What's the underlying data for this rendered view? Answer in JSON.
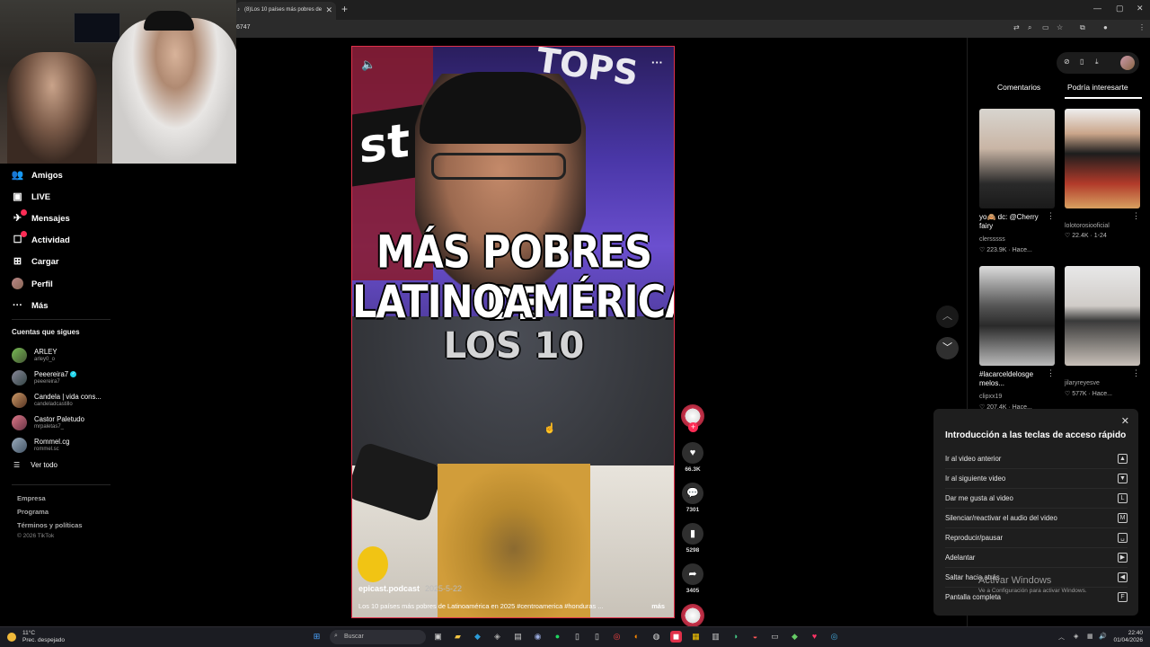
{
  "browser": {
    "tab_title": "(8)Los 10 países más pobres de",
    "url": "6747",
    "new_tab_icon": "plus-icon"
  },
  "sidebar": {
    "items": [
      {
        "label": "Amigos",
        "icon": "friends-icon"
      },
      {
        "label": "LIVE",
        "icon": "live-icon"
      },
      {
        "label": "Mensajes",
        "icon": "messages-icon"
      },
      {
        "label": "Actividad",
        "icon": "activity-icon"
      },
      {
        "label": "Cargar",
        "icon": "upload-icon"
      },
      {
        "label": "Perfil",
        "icon": "avatar"
      },
      {
        "label": "Más",
        "icon": "more-icon"
      }
    ],
    "following_title": "Cuentas que sigues",
    "following": [
      {
        "name": "ARLEY",
        "handle": "arley0_o"
      },
      {
        "name": "Peeereira7",
        "handle": "peeereira7"
      },
      {
        "name": "Candela | vida cons...",
        "handle": "candeladcastillo"
      },
      {
        "name": "Castor Paletudo",
        "handle": "mrpaletas7_"
      },
      {
        "name": "Rommel.cg",
        "handle": "rommel.sc"
      }
    ],
    "see_all": "Ver todo",
    "footer": [
      "Empresa",
      "Programa",
      "Términos y políticas"
    ],
    "copyright": "© 2026 TikTok"
  },
  "video": {
    "overlay_line1": "MÁS POBRES DE",
    "overlay_line2": "LATINOAMÉRICA",
    "overlay_line3": "LOS 10",
    "sign_text": "st",
    "top_text": "TOPS",
    "author": "epicast.podcast",
    "date": "2025-5-22",
    "description": "Los 10 países más pobres de Latinoamérica en 2025 #centroamerica #honduras ...",
    "more": "más"
  },
  "actions": {
    "likes": "66.3K",
    "comments": "7301",
    "saves": "5298",
    "shares": "3405"
  },
  "right_panel": {
    "tab_comments": "Comentarios",
    "tab_suggested": "Podría interesarte",
    "suggestions": [
      {
        "desc": "yo🙈 dc: @Cherry fairy",
        "user": "clersssss",
        "stat": "♡ 223.9K · Hace..."
      },
      {
        "desc": "",
        "user": "lolotorosiooficial",
        "stat": "♡ 22.4K · 1-24"
      },
      {
        "desc": "#lacarceldelosge melos...",
        "user": "clipxx19",
        "stat": "♡ 207.4K · Hace..."
      },
      {
        "desc": "",
        "user": "jilaryreyesve",
        "stat": "♡ 577K · Hace..."
      }
    ]
  },
  "shortcuts": {
    "title": "Introducción a las teclas de acceso rápido",
    "items": [
      {
        "label": "Ir al video anterior",
        "key": "▲"
      },
      {
        "label": "Ir al siguiente video",
        "key": "▼"
      },
      {
        "label": "Dar me gusta al video",
        "key": "L"
      },
      {
        "label": "Silenciar/reactivar el audio del video",
        "key": "M"
      },
      {
        "label": "Reproducir/pausar",
        "key": "␣"
      },
      {
        "label": "Adelantar",
        "key": "▶"
      },
      {
        "label": "Saltar hacia atrás",
        "key": "◀"
      },
      {
        "label": "Pantalla completa",
        "key": "F"
      }
    ]
  },
  "windows_activation": {
    "title": "Activar Windows",
    "subtitle": "Ve a Configuración para activar Windows."
  },
  "taskbar": {
    "temp": "11°C",
    "weather": "Prec. despejado",
    "search_placeholder": "Buscar",
    "time": "22:40",
    "date": "01/04/2026"
  }
}
